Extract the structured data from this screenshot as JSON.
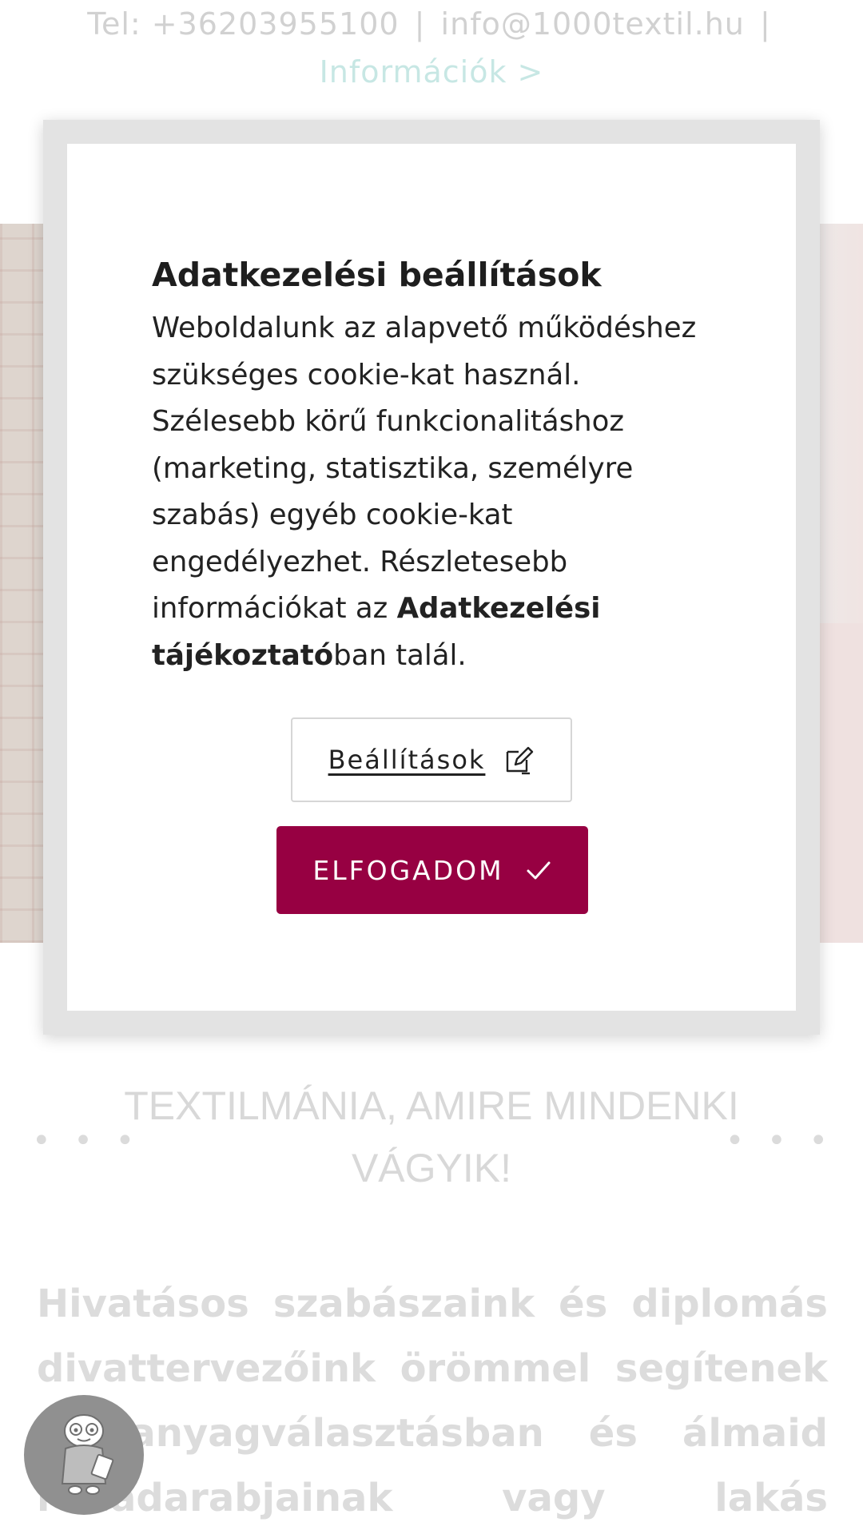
{
  "topbar": {
    "phone": "Tel: +36203955100",
    "separator": "|",
    "email": "info@1000textil.hu",
    "info_link": "Információk >"
  },
  "section": {
    "dots": "• • •",
    "title": "TEXTILMÁNIA, AMIRE MINDENKI VÁGYIK!",
    "intro": "Hivatásos szabászaink és diplomás divattervezőink örömmel segítenek az anyagválasztásban és álmaid ruhadarabjainak vagy lakás"
  },
  "cookie_modal": {
    "title": "Adatkezelési beállítások",
    "body_text": "Weboldalunk az alapvető működéshez szükséges cookie-kat használ. Szélesebb körű funkcionalitáshoz (marketing, statisztika, személyre szabás) egyéb cookie-kat engedélyezhet. Részletesebb információkat az",
    "policy_link": "Adatkezelési tájékoztató",
    "body_suffix": "ban talál.",
    "settings_button": "Beállítások",
    "accept_button": "ELFOGADOM"
  },
  "icons": {
    "settings": "edit-icon",
    "accept": "checkmark-icon",
    "help": "assistant-icon"
  },
  "colors": {
    "accent": "#970042",
    "info_link": "#a9dbd6"
  }
}
